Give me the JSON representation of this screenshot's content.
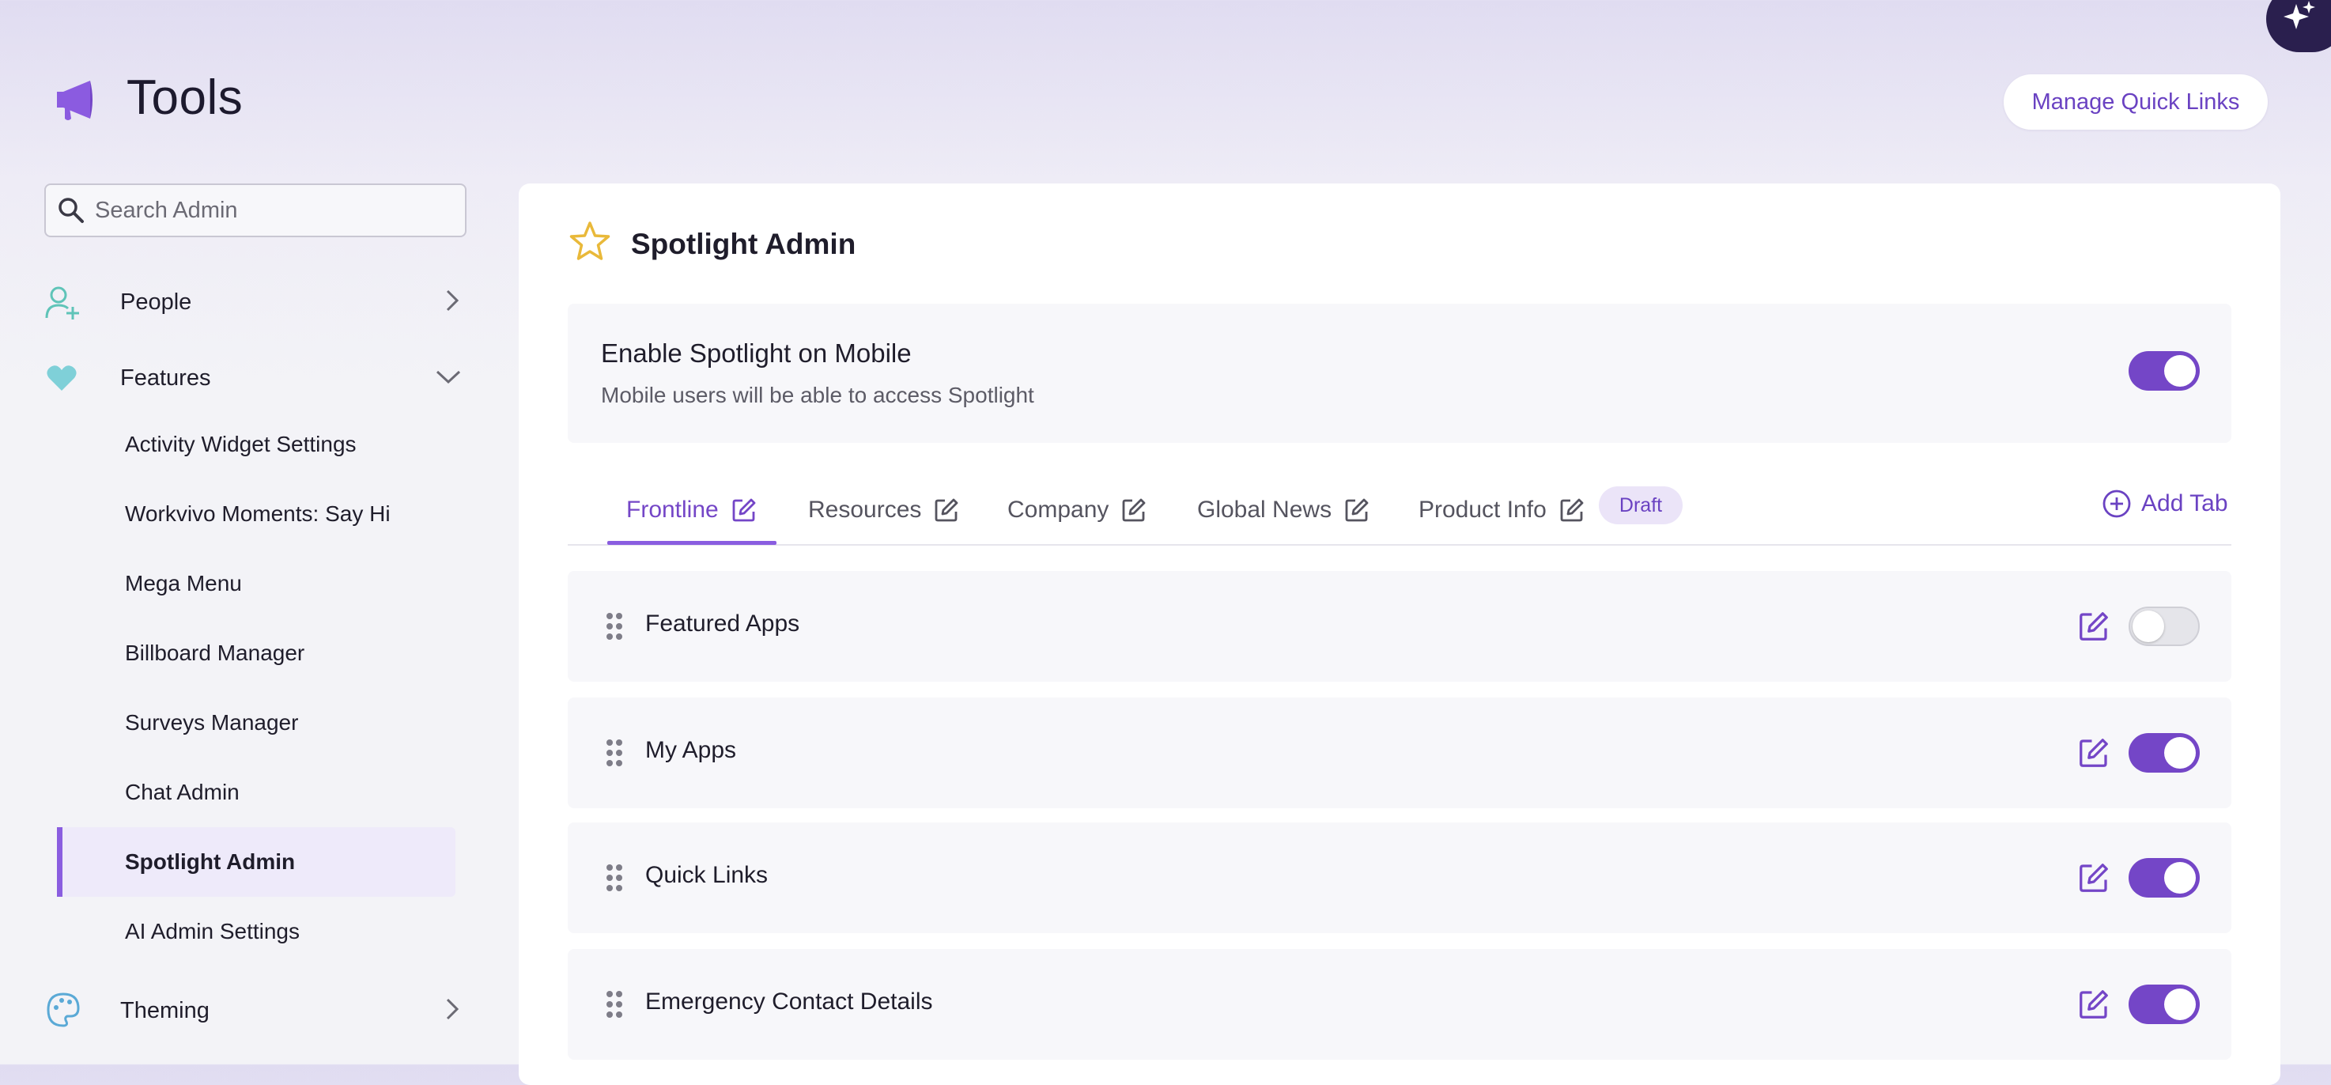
{
  "header": {
    "title": "Tools",
    "quick_links_label": "Manage Quick Links",
    "logo_icon": "megaphone-icon",
    "ai_icon": "sparkle-icon"
  },
  "sidebar": {
    "search_placeholder": "Search Admin",
    "groups": [
      {
        "label": "People",
        "icon": "add-user-icon",
        "expanded": false
      },
      {
        "label": "Features",
        "icon": "heart-icon",
        "expanded": true
      },
      {
        "label": "Theming",
        "icon": "palette-icon",
        "expanded": false
      }
    ],
    "feature_items": [
      "Activity Widget Settings",
      "Workvivo Moments: Say Hi",
      "Mega Menu",
      "Billboard Manager",
      "Surveys Manager",
      "Chat Admin",
      "Spotlight Admin",
      "AI Admin Settings"
    ],
    "active_item": "Spotlight Admin"
  },
  "main": {
    "title": "Spotlight Admin",
    "mobile": {
      "title": "Enable Spotlight on Mobile",
      "description": "Mobile users will be able to access Spotlight",
      "enabled": true
    },
    "tabs": [
      {
        "label": "Frontline",
        "active": true
      },
      {
        "label": "Resources",
        "active": false
      },
      {
        "label": "Company",
        "active": false
      },
      {
        "label": "Global News",
        "active": false
      },
      {
        "label": "Product Info",
        "active": false,
        "badge": "Draft"
      }
    ],
    "add_tab_label": "Add Tab",
    "rows": [
      {
        "label": "Featured Apps",
        "enabled": false
      },
      {
        "label": "My Apps",
        "enabled": true
      },
      {
        "label": "Quick Links",
        "enabled": true
      },
      {
        "label": "Emergency Contact Details",
        "enabled": true
      }
    ]
  },
  "colors": {
    "accent": "#7446c7",
    "accent_light": "#ebe4f8",
    "star": "#e9b93a",
    "teal_icon": "#5fc4b8"
  }
}
